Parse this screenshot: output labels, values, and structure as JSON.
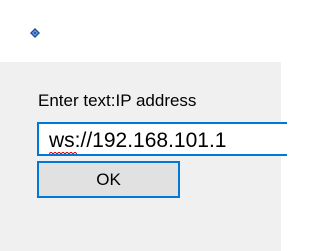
{
  "window": {
    "icon": "app-diamond-icon",
    "accent_color": "#0078d7",
    "background_color": "#f0f0f0"
  },
  "dialog": {
    "prompt_label": "Enter text:IP address",
    "input_value": "ws://192.168.101.1",
    "ok_label": "OK"
  }
}
